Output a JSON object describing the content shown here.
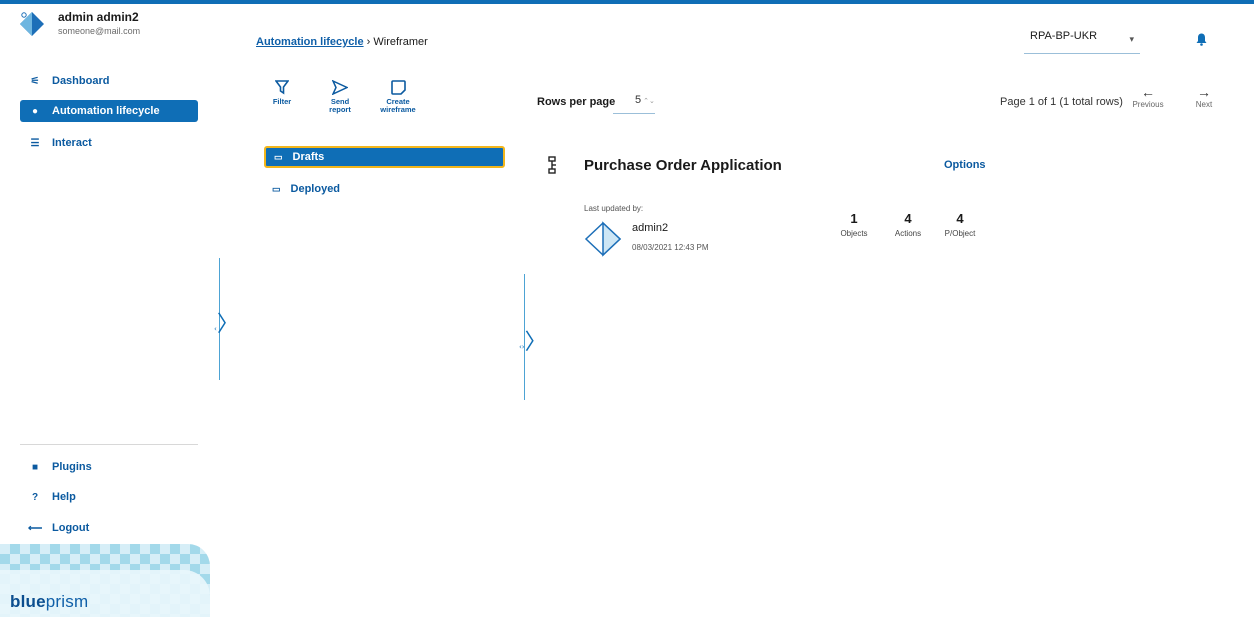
{
  "user": {
    "name": "admin admin2",
    "email": "someone@mail.com",
    "avatar_icon": "blueprism-diamond-icon"
  },
  "sidebar": {
    "items": [
      {
        "label": "Dashboard",
        "icon": "dashboard-icon",
        "glyph": "⚟"
      },
      {
        "label": "Automation lifecycle",
        "icon": "lifecycle-icon",
        "glyph": "●"
      },
      {
        "label": "Interact",
        "icon": "interact-icon",
        "glyph": "☰"
      }
    ],
    "bottom_items": [
      {
        "label": "Plugins",
        "icon": "plugins-icon",
        "glyph": "■"
      },
      {
        "label": "Help",
        "icon": "help-icon",
        "glyph": "?"
      },
      {
        "label": "Logout",
        "icon": "logout-icon",
        "glyph": "⟵"
      }
    ],
    "brand": {
      "strong": "blue",
      "rest": "prism"
    }
  },
  "breadcrumb": {
    "parent": "Automation lifecycle",
    "separator": "›",
    "current": "Wireframer"
  },
  "environment": {
    "selected": "RPA-BP-UKR"
  },
  "toolbar": {
    "filter": {
      "label": "Filter"
    },
    "send_report": {
      "label_line1": "Send",
      "label_line2": "report"
    },
    "create_wireframe": {
      "label_line1": "Create",
      "label_line2": "wireframe"
    }
  },
  "folders": [
    {
      "label": "Drafts",
      "selected": true
    },
    {
      "label": "Deployed",
      "selected": false
    }
  ],
  "pagination": {
    "rows_label": "Rows per page",
    "rows_value": "5",
    "info": "Page 1 of 1 (1 total rows)",
    "previous": "Previous",
    "next": "Next"
  },
  "card": {
    "title": "Purchase Order Application",
    "options_label": "Options",
    "last_updated_label": "Last updated by:",
    "updated_by": "admin2",
    "updated_at": "08/03/2021 12:43 PM",
    "stats": [
      {
        "value": "1",
        "label": "Objects"
      },
      {
        "value": "4",
        "label": "Actions"
      },
      {
        "value": "4",
        "label": "P/Object"
      }
    ]
  },
  "colors": {
    "primary": "#0f6eb6",
    "highlight": "#f2b61c",
    "link": "#0b5aa0"
  }
}
